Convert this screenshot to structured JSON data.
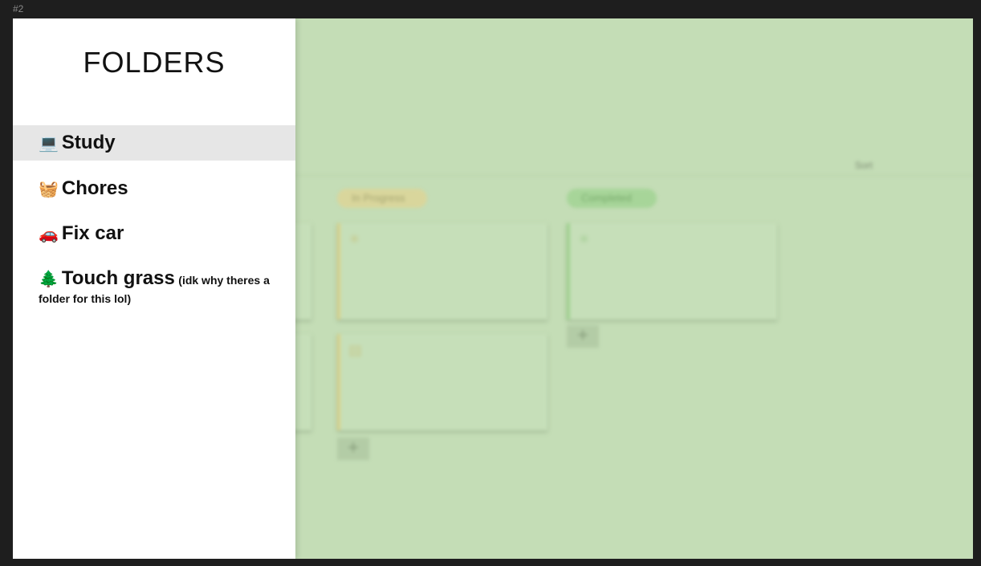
{
  "frame": {
    "label": "#2"
  },
  "panel": {
    "title": "FOLDERS",
    "folders": [
      {
        "emoji": "💻",
        "name": "Study",
        "note": "",
        "active": true
      },
      {
        "emoji": "🧺",
        "name": "Chores",
        "note": "",
        "active": false
      },
      {
        "emoji": "🚗",
        "name": "Fix car",
        "note": "",
        "active": false
      },
      {
        "emoji": "🌲",
        "name": "Touch grass",
        "note": "(idk why theres a folder for this lol)",
        "active": false
      }
    ]
  },
  "board": {
    "sort_label": "Sort",
    "columns": [
      {
        "label": "In Progress",
        "color": "#d9d69c"
      },
      {
        "label": "Completed",
        "color": "#a7d599"
      }
    ],
    "add_label": "+",
    "card_icons": [
      "bug-icon",
      "document-icon"
    ]
  }
}
